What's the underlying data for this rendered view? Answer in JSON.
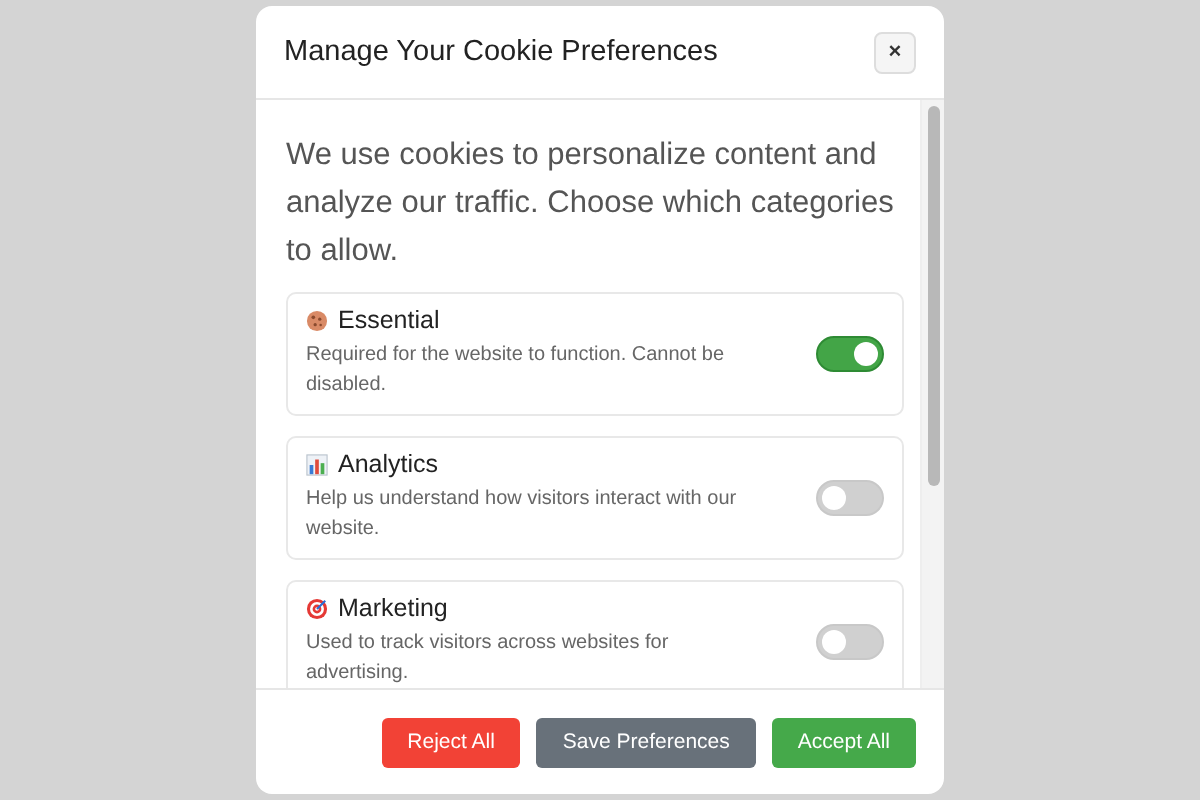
{
  "dialog": {
    "title": "Manage Your Cookie Preferences",
    "close": "×"
  },
  "intro": "We use cookies to personalize content and analyze our traffic. Choose which categories to allow.",
  "categories": [
    {
      "kind": "cookie",
      "name": "Essential",
      "description": "Required for the website to function. Cannot be disabled.",
      "on": true
    },
    {
      "kind": "chart",
      "name": "Analytics",
      "description": "Help us understand how visitors interact with our website.",
      "on": false
    },
    {
      "kind": "target",
      "name": "Marketing",
      "description": "Used to track visitors across websites for advertising.",
      "on": false
    }
  ],
  "buttons": [
    {
      "kind": "reject",
      "label": "Reject All"
    },
    {
      "kind": "save",
      "label": "Save Preferences"
    },
    {
      "kind": "accept",
      "label": "Accept All"
    }
  ]
}
